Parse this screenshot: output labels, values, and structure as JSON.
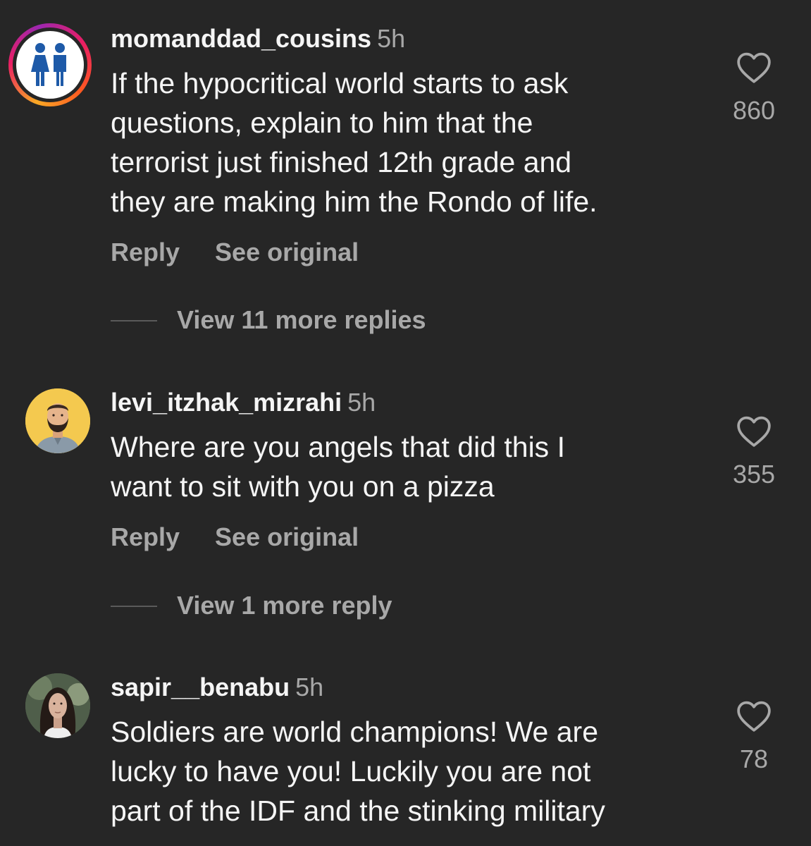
{
  "comments": [
    {
      "username": "momanddad_cousins",
      "time": "5h",
      "text_lines": [
        "If the hypocritical world starts to ask",
        "questions, explain to him that the",
        "terrorist just finished 12th grade and",
        "they are making him the Rondo of life."
      ],
      "likes": "860",
      "reply_label": "Reply",
      "see_original_label": "See original",
      "view_replies": "View 11 more replies",
      "avatar_icon": "parents-icon"
    },
    {
      "username": "levi_itzhak_mizrahi",
      "time": "5h",
      "text_lines": [
        "Where are you angels that did this I",
        "want to sit with you on a pizza"
      ],
      "likes": "355",
      "reply_label": "Reply",
      "see_original_label": "See original",
      "view_replies": "View 1 more reply",
      "avatar_icon": "cartoon-man-avatar"
    },
    {
      "username": "sapir__benabu",
      "time": "5h",
      "text_lines": [
        "Soldiers are world champions! We are",
        "lucky to have you! Luckily you are not",
        "part of the IDF and the stinking military"
      ],
      "likes": "78",
      "avatar_icon": "profile-photo"
    }
  ],
  "colors": {
    "background": "#262626",
    "text": "#f5f5f5",
    "secondary_text": "#a8a8a8",
    "avatar_icon_blue": "#1e5aa8",
    "avatar2_background": "#f4c94f"
  }
}
